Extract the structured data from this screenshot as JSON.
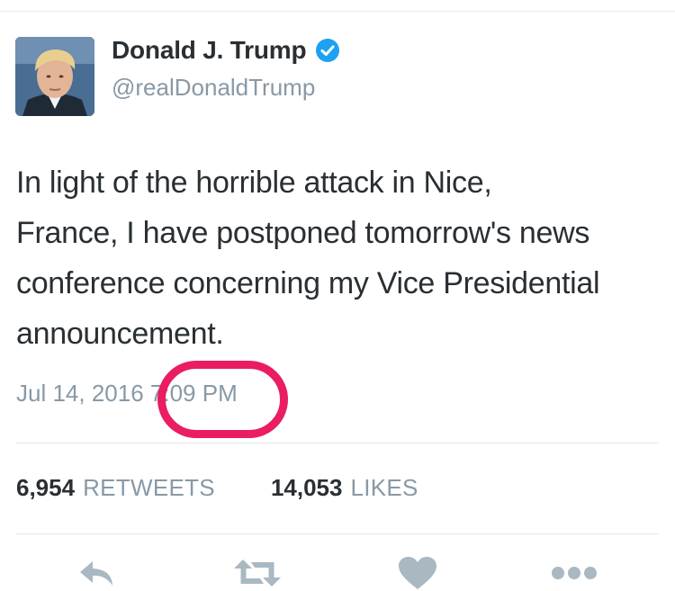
{
  "tweet": {
    "author": {
      "display_name": "Donald J. Trump",
      "handle": "@realDonaldTrump",
      "verified": true
    },
    "text": "In light of the horrible attack in Nice,\nFrance, I have postponed tomorrow's news\nconference concerning my Vice Presidential\nannouncement.",
    "date": "Jul 14, 2016",
    "time": "7:09 PM",
    "stats": {
      "retweets": {
        "count": "6,954",
        "label": "RETWEETS"
      },
      "likes": {
        "count": "14,053",
        "label": "LIKES"
      }
    },
    "actions": [
      "reply-icon",
      "retweet-icon",
      "like-icon",
      "more-icon"
    ]
  },
  "colors": {
    "text": "#292f33",
    "muted": "#8899a6",
    "verified_blue": "#1da1f2",
    "annotation_circle": "#ea1c63",
    "icon_gray": "#aab8c2"
  }
}
